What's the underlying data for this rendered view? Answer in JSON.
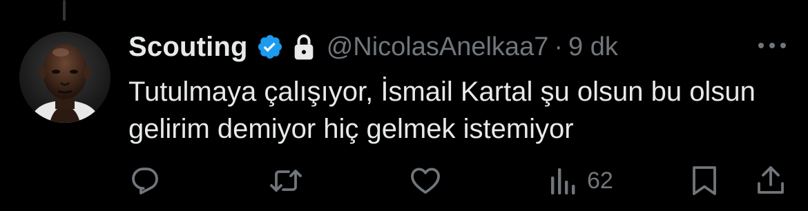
{
  "tweet": {
    "display_name": "Scouting",
    "verified_icon": "verified-badge-icon",
    "protected_icon": "lock-icon",
    "handle": "@NicolasAnelkaa7",
    "separator": "·",
    "time": "9 dk",
    "text": "Tutulmaya çalışıyor, İsmail Kartal şu olsun bu olsun gelirim demiyor hiç gelmek istemiyor"
  },
  "actions": {
    "reply_icon": "reply-icon",
    "retweet_icon": "retweet-icon",
    "like_icon": "heart-icon",
    "views_icon": "views-icon",
    "views_count": "62",
    "bookmark_icon": "bookmark-icon",
    "share_icon": "share-icon"
  },
  "more_icon": "more-icon",
  "colors": {
    "background": "#000000",
    "primary_text": "#e7e9ea",
    "secondary_text": "#71767b",
    "verified_blue": "#1d9bf0"
  }
}
